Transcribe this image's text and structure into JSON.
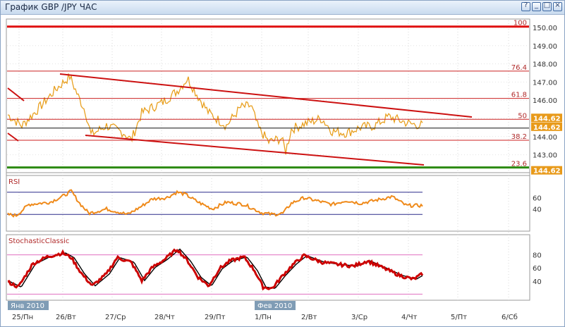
{
  "window": {
    "title": "График GBP /JPY  ЧАС",
    "buttons": [
      "help",
      "minimize",
      "maximize",
      "close"
    ]
  },
  "colors": {
    "price": "#e8a020",
    "fib": "#cc2222",
    "fib_top": "#e01010",
    "fib_bottom": "#2c8a10",
    "trendline": "#cc1111",
    "current_line": "#111111",
    "rsi_line": "#ef8a1a",
    "rsi_levels": "#2a2a8a",
    "stoch_main": "#cc0000",
    "stoch_signal": "#000000",
    "stoch_levels": "#e070c0",
    "price_tag_bg": "#e89a1a",
    "date_tag_bg": "#7f9cb5"
  },
  "price_panel": {
    "y_axis_ticks": [
      "150.00",
      "149.00",
      "148.00",
      "147.00",
      "146.00",
      "145.00",
      "144.00",
      "143.00"
    ],
    "fib_levels": [
      {
        "label": "100",
        "price": 150.05
      },
      {
        "label": "76.4",
        "price": 147.6
      },
      {
        "label": "61.8",
        "price": 146.1
      },
      {
        "label": "50",
        "price": 144.95
      },
      {
        "label": "38.2",
        "price": 143.8
      },
      {
        "label": "23.6",
        "price": 142.3
      }
    ],
    "price_tags": [
      "144.62",
      "144.62",
      "144.62"
    ],
    "current_price": "144.62"
  },
  "rsi_panel": {
    "name": "RSI",
    "levels": [
      70,
      30
    ],
    "y_axis_ticks": [
      "60",
      "40"
    ]
  },
  "stoch_panel": {
    "name": "StochasticClassic",
    "levels": [
      80,
      20
    ],
    "y_axis_ticks": [
      "80",
      "60",
      "40"
    ]
  },
  "x_axis": {
    "labels": [
      "25/Пн",
      "26/Вт",
      "27/Ср",
      "28/Чт",
      "29/Пт",
      "1/Пн",
      "2/Вт",
      "3/Ср",
      "4/Чт",
      "5/Пт",
      "6/Сб"
    ],
    "date_tags": [
      "Янв 2010",
      "Фев 2010"
    ]
  }
}
